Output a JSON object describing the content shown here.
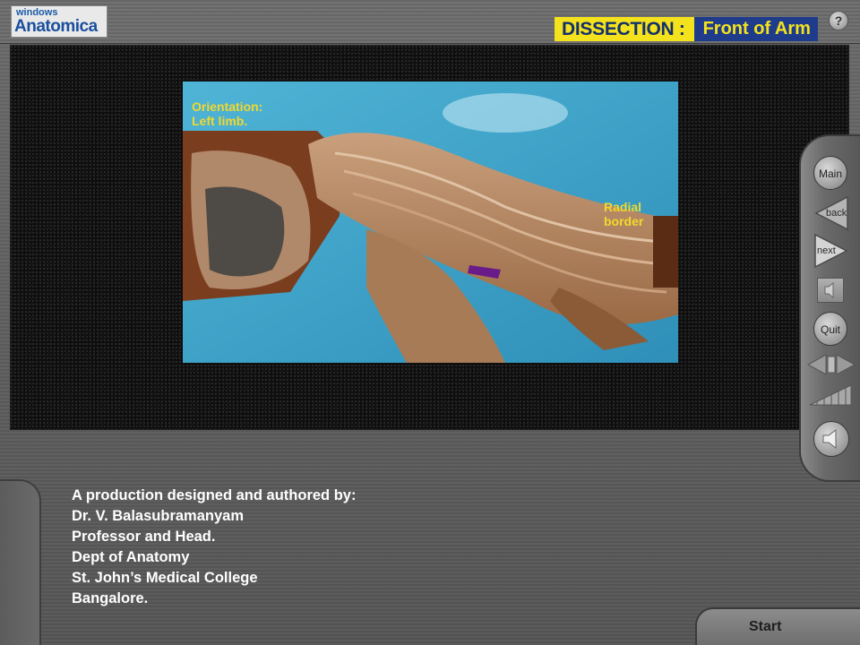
{
  "app": {
    "logo_small": "windows",
    "logo_big": "Anatomica"
  },
  "header": {
    "section_label": "DISSECTION :",
    "section_title": "Front of Arm",
    "help_label": "?"
  },
  "photo": {
    "annotation_orientation": [
      "Orientation:",
      "Left limb."
    ],
    "annotation_radial": [
      "Radial",
      "border"
    ]
  },
  "controls": {
    "main_label": "Main",
    "back_label": "back",
    "next_label": "next",
    "quit_label": "Quit"
  },
  "credits": {
    "lines": [
      "A production designed and authored by:",
      "Dr. V. Balasubramanyam",
      "Professor and Head.",
      "Dept of Anatomy",
      "St. John’s Medical College",
      "Bangalore."
    ]
  },
  "footer": {
    "start_label": "Start"
  },
  "colors": {
    "accent_yellow": "#f4e21c",
    "accent_blue": "#1f3c8c",
    "annotation_yellow": "#f2d82a"
  }
}
